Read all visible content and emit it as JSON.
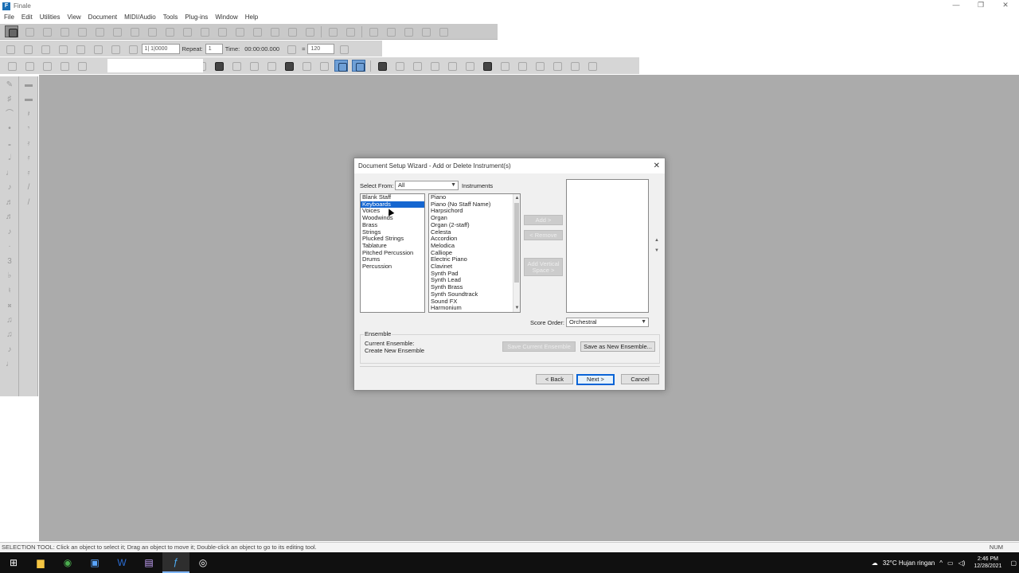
{
  "window": {
    "title": "Finale",
    "icon_letter": "F",
    "minimize": "—",
    "maximize": "❐",
    "close": "✕"
  },
  "menu": [
    "File",
    "Edit",
    "Utilities",
    "View",
    "Document",
    "MIDI/Audio",
    "Tools",
    "Plug-ins",
    "Window",
    "Help"
  ],
  "playback": {
    "measure": "1| 1|0000",
    "repeat_label": "Repeat:",
    "repeat_value": "1",
    "time_label": "Time:",
    "time_value": "00:00:00.000",
    "tempo_eq": "=",
    "tempo_value": "120"
  },
  "dialog": {
    "title": "Document Setup Wizard - Add or Delete Instrument(s)",
    "close_icon": "✕",
    "select_from_label": "Select From:",
    "select_from_value": "All",
    "instruments_label": "Instruments",
    "categories": [
      "Blank Staff",
      "Keyboards",
      "Voices",
      "Woodwinds",
      "Brass",
      "Strings",
      "Plucked Strings",
      "Tablature",
      "Pitched Percussion",
      "Drums",
      "Percussion"
    ],
    "selected_category": "Keyboards",
    "instruments": [
      "Piano",
      "Piano (No Staff Name)",
      "Harpsichord",
      "Organ",
      "Organ (2-staff)",
      "Celesta",
      "Accordion",
      "Melodica",
      "Calliope",
      "Electric Piano",
      "Clavinet",
      "Synth Pad",
      "Synth Lead",
      "Synth Brass",
      "Synth Soundtrack",
      "Sound FX",
      "Harmonium"
    ],
    "add_button": "Add >",
    "remove_button": "< Remove",
    "add_vertical_space_line1": "Add Vertical",
    "add_vertical_space_line2": "Space >",
    "score_order_label": "Score Order:",
    "score_order_value": "Orchestral",
    "ensemble_group_label": "Ensemble",
    "current_ensemble_label": "Current Ensemble:",
    "current_ensemble_value": "Create New Ensemble",
    "save_current_ensemble": "Save Current Ensemble",
    "save_as_new_ensemble": "Save as New Ensemble...",
    "back_button": "< Back",
    "next_button": "Next >",
    "cancel_button": "Cancel",
    "move_up_icon": "▲",
    "move_down_icon": "▼"
  },
  "status": {
    "text": "SELECTION TOOL: Click an object to select it; Drag an object to move it; Double-click an object to go to its editing tool.",
    "num": "NUM"
  },
  "taskbar": {
    "weather": "32°C  Hujan ringan",
    "time": "2:46 PM",
    "date": "12/28/2021"
  },
  "colors": {
    "selection": "#1566d0",
    "workspace": "#ababab",
    "taskbar": "#101010"
  }
}
